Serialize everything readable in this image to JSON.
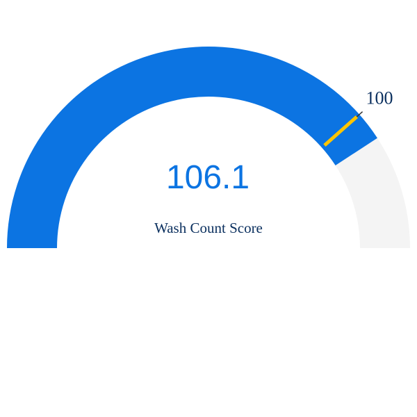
{
  "chart_data": {
    "type": "gauge",
    "value": 106.1,
    "value_text": "106.1",
    "label": "Wash Count Score",
    "threshold": 100,
    "threshold_text": "100",
    "min": 0,
    "max": 130
  },
  "colors": {
    "track": "#f4f4f4",
    "fill": "#0c74e2",
    "threshold_marker": "#ffc500",
    "threshold_leader": "#333333",
    "value_text": "#0c74e2",
    "label_text": "#0a2f5e",
    "threshold_text": "#0a2f5e"
  }
}
